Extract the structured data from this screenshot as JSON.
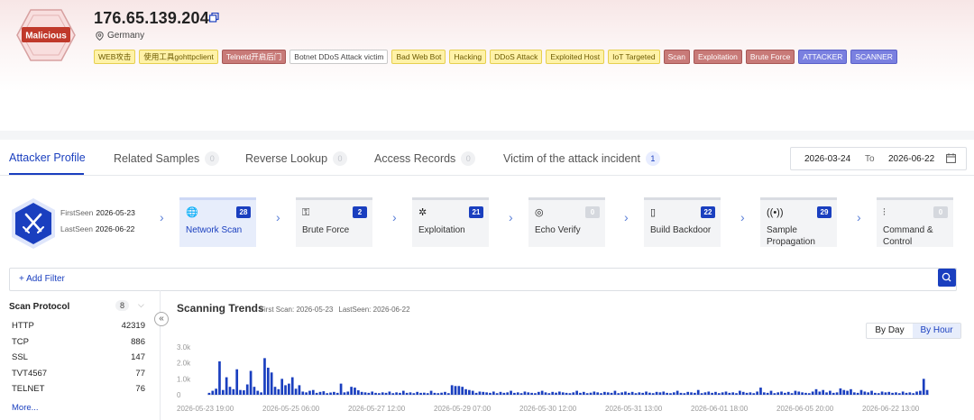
{
  "header": {
    "badge_label": "Malicious",
    "ip": "176.65.139.204",
    "location": "Germany",
    "tags": [
      {
        "label": "WEB攻击",
        "style": "yellow"
      },
      {
        "label": "使用工具gohttpclient",
        "style": "yellow"
      },
      {
        "label": "Telnetd开启后门",
        "style": "red"
      },
      {
        "label": "Botnet DDoS Attack victim",
        "style": "gray"
      },
      {
        "label": "Bad Web Bot",
        "style": "yellow"
      },
      {
        "label": "Hacking",
        "style": "yellow"
      },
      {
        "label": "DDoS Attack",
        "style": "yellow"
      },
      {
        "label": "Exploited Host",
        "style": "yellow"
      },
      {
        "label": "IoT Targeted",
        "style": "yellow"
      },
      {
        "label": "Scan",
        "style": "red"
      },
      {
        "label": "Exploitation",
        "style": "red"
      },
      {
        "label": "Brute Force",
        "style": "red"
      },
      {
        "label": "ATTACKER",
        "style": "blue"
      },
      {
        "label": "SCANNER",
        "style": "blue"
      }
    ]
  },
  "tabs": [
    {
      "label": "Attacker Profile",
      "count": null,
      "active": true
    },
    {
      "label": "Related Samples",
      "count": "0",
      "active": false
    },
    {
      "label": "Reverse Lookup",
      "count": "0",
      "active": false
    },
    {
      "label": "Access Records",
      "count": "0",
      "active": false
    },
    {
      "label": "Victim of the attack incident",
      "count": "1",
      "active": false
    }
  ],
  "date_range": {
    "from": "2026-03-24",
    "to_label": "To",
    "to": "2026-06-22"
  },
  "seen": {
    "first_label": "FirstSeen",
    "first": "2026-05-23",
    "last_label": "LastSeen",
    "last": "2026-06-22"
  },
  "phases": [
    {
      "name": "Network Scan",
      "count": "28",
      "icon": "globe-icon",
      "glyph": "🌐",
      "active": true
    },
    {
      "name": "Brute Force",
      "count": "2",
      "icon": "key-icon",
      "glyph": "⚿",
      "active": false
    },
    {
      "name": "Exploitation",
      "count": "21",
      "icon": "bug-icon",
      "glyph": "✲",
      "active": false
    },
    {
      "name": "Echo Verify",
      "count": "0",
      "icon": "verify-icon",
      "glyph": "◎",
      "active": false
    },
    {
      "name": "Build Backdoor",
      "count": "22",
      "icon": "door-icon",
      "glyph": "▯",
      "active": false
    },
    {
      "name": "Sample Propagation",
      "count": "29",
      "icon": "broadcast-icon",
      "glyph": "((•))",
      "active": false
    },
    {
      "name": "Command & Control",
      "count": "0",
      "icon": "sliders-icon",
      "glyph": "⫶",
      "active": false
    }
  ],
  "filter": {
    "add_label": "+ Add Filter"
  },
  "scan_protocol": {
    "title": "Scan Protocol",
    "count": "8",
    "items": [
      {
        "name": "HTTP",
        "value": "42319"
      },
      {
        "name": "TCP",
        "value": "886"
      },
      {
        "name": "SSL",
        "value": "147"
      },
      {
        "name": "TVT4567",
        "value": "77"
      },
      {
        "name": "TELNET",
        "value": "76"
      }
    ],
    "more_label": "More..."
  },
  "trend": {
    "title": "Scanning Trends",
    "first_scan": "First Scan: 2026-05-23",
    "last_seen": "LastSeen: 2026-06-22",
    "toggle": {
      "by_day": "By Day",
      "by_hour": "By Hour",
      "selected": "By Hour"
    }
  },
  "chart_data": {
    "type": "bar",
    "title": "Scanning Trends",
    "y_ticks": [
      "3.0k",
      "2.0k",
      "1.0k",
      "0"
    ],
    "ylim": [
      0,
      3000
    ],
    "x_tick_labels": [
      "2026-05-23 19:00",
      "2026-05-25 06:00",
      "2026-05-27 12:00",
      "2026-05-29 07:00",
      "2026-05-30 12:00",
      "2026-05-31 13:00",
      "2026-06-01 18:00",
      "2026-06-05 20:00",
      "2026-06-22 13:00"
    ],
    "values": [
      120,
      250,
      380,
      2100,
      300,
      1100,
      500,
      350,
      1600,
      300,
      280,
      650,
      1500,
      500,
      250,
      150,
      2300,
      1700,
      1400,
      500,
      350,
      1000,
      600,
      700,
      1100,
      380,
      600,
      200,
      150,
      250,
      300,
      120,
      180,
      220,
      100,
      140,
      180,
      120,
      700,
      150,
      200,
      500,
      450,
      280,
      180,
      150,
      120,
      200,
      120,
      100,
      150,
      120,
      200,
      100,
      150,
      120,
      250,
      120,
      150,
      100,
      180,
      120,
      130,
      100,
      250,
      120,
      100,
      130,
      180,
      100,
      600,
      550,
      550,
      500,
      350,
      300,
      250,
      120,
      200,
      180,
      150,
      120,
      200,
      100,
      180,
      120,
      150,
      250,
      120,
      150,
      100,
      200,
      150,
      120,
      100,
      180,
      250,
      150,
      100,
      180,
      130,
      200,
      150,
      120,
      100,
      150,
      250,
      120,
      180,
      100,
      130,
      200,
      150,
      100,
      180,
      150,
      120,
      250,
      100,
      150,
      200,
      120,
      180,
      100,
      150,
      120,
      200,
      130,
      100,
      180,
      150,
      200,
      120,
      100,
      150,
      250,
      120,
      100,
      180,
      150,
      120,
      300,
      100,
      150,
      200,
      120,
      180,
      100,
      150,
      200,
      120,
      150,
      100,
      250,
      180,
      120,
      150,
      100,
      200,
      450,
      150,
      120,
      250,
      100,
      150,
      200,
      120,
      180,
      100,
      250,
      200,
      150,
      120,
      100,
      200,
      350,
      200,
      300,
      150,
      250,
      120,
      150,
      400,
      300,
      250,
      350,
      150,
      120,
      300,
      200,
      150,
      250,
      120,
      100,
      200,
      150,
      180,
      120,
      150,
      100,
      200,
      120,
      150,
      100,
      200,
      250,
      1000,
      300
    ]
  }
}
